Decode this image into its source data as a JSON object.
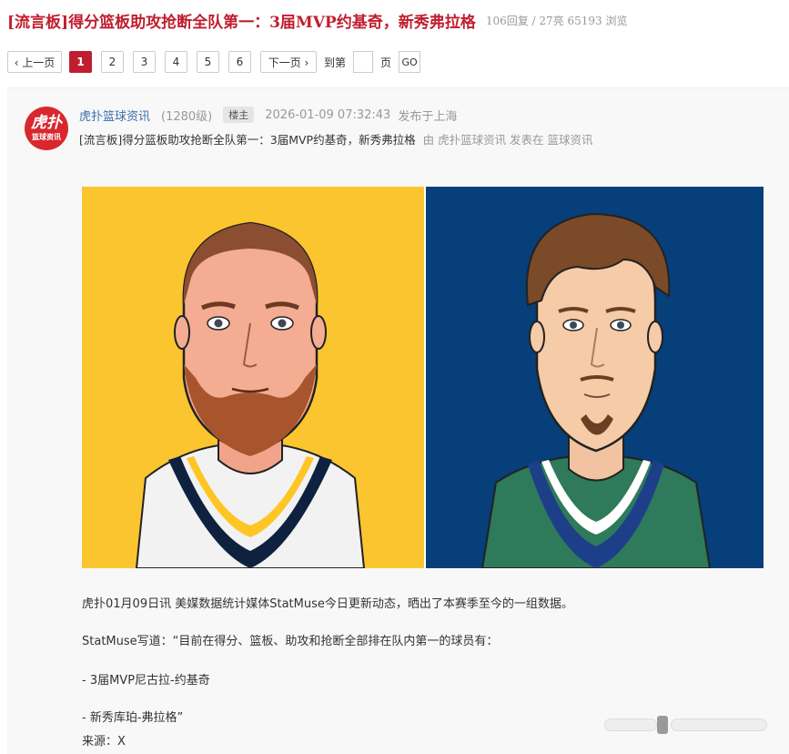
{
  "thread": {
    "title": "[流言板]得分篮板助攻抢断全队第一：3届MVP约基奇，新秀弗拉格",
    "stats": "106回复 / 27亮 65193 浏览"
  },
  "pagination": {
    "prev_label": "‹ 上一页",
    "pages": [
      "1",
      "2",
      "3",
      "4",
      "5",
      "6"
    ],
    "current_page": "1",
    "next_label": "下一页 ›",
    "jump_prefix": "到第",
    "jump_suffix": "页",
    "go_label": "GO"
  },
  "post": {
    "avatar": {
      "line1": "虎扑",
      "line2": "篮球资讯"
    },
    "author": "虎扑篮球资讯",
    "level": "(1280级)",
    "role_badge": "楼主",
    "time": "2026-01-09 07:32:43",
    "location": "发布于上海",
    "ref_title": "[流言板]得分篮板助攻抢断全队第一：3届MVP约基奇，新秀弗拉格",
    "ref_by": "由 虎扑篮球资讯 发表在 篮球资讯",
    "image": {
      "left_bg": "#fbc52f",
      "right_bg": "#063f79",
      "left_jersey": "#f2f2f2",
      "left_trim": "#0e2240",
      "left_trim2": "#fec524",
      "right_jersey": "#2e7a5a",
      "right_trim": "#1d3f8a"
    },
    "body": [
      "虎扑01月09日讯 美媒数据统计媒体StatMuse今日更新动态，晒出了本赛季至今的一组数据。",
      "StatMuse写道：“目前在得分、篮板、助攻和抢断全部排在队内第一的球员有：",
      "- 3届MVP尼古拉-约基奇",
      "- 新秀库珀-弗拉格”",
      "来源：X"
    ]
  }
}
